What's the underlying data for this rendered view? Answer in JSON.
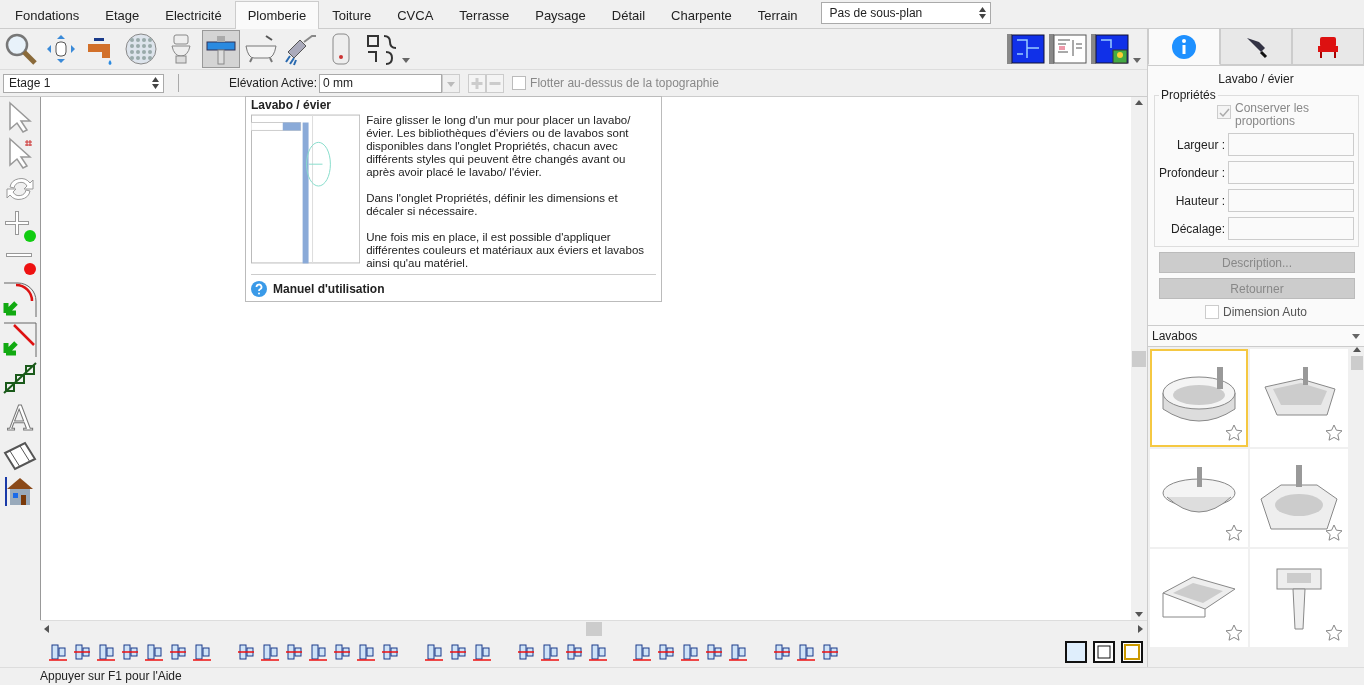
{
  "tabs": [
    {
      "label": "Fondations",
      "selected": false
    },
    {
      "label": "Etage",
      "selected": false
    },
    {
      "label": "Electricité",
      "selected": false
    },
    {
      "label": "Plomberie",
      "selected": true
    },
    {
      "label": "Toiture",
      "selected": false
    },
    {
      "label": "CVCA",
      "selected": false
    },
    {
      "label": "Terrasse",
      "selected": false
    },
    {
      "label": "Paysage",
      "selected": false
    },
    {
      "label": "Détail",
      "selected": false
    },
    {
      "label": "Charpente",
      "selected": false
    },
    {
      "label": "Terrain",
      "selected": false
    }
  ],
  "plan_select": {
    "value": "Pas de sous-plan"
  },
  "toolbar": [
    {
      "kind": "zoom",
      "selected": false
    },
    {
      "kind": "pan",
      "selected": false
    },
    {
      "kind": "faucet",
      "selected": false
    },
    {
      "kind": "drain",
      "selected": false
    },
    {
      "kind": "toilet",
      "selected": false
    },
    {
      "kind": "sink",
      "selected": true
    },
    {
      "kind": "bathtub",
      "selected": false
    },
    {
      "kind": "shower",
      "selected": false
    },
    {
      "kind": "heater",
      "selected": false
    },
    {
      "kind": "pipes",
      "selected": false
    }
  ],
  "floor_select": {
    "value": "Etage 1"
  },
  "elevation": {
    "label": "Elévation Active:",
    "value": "0 mm"
  },
  "float_option": {
    "label": "Flotter au-dessus de la topographie",
    "checked": false
  },
  "text_tool": {
    "glyph": "A"
  },
  "tooltip": {
    "title": "Lavabo / évier",
    "paragraphs": [
      "Faire glisser le long d'un mur pour placer un lavabo/évier. Les bibliothèques d'éviers ou de lavabos sont disponibles dans l'onglet Propriétés, chacun avec différents styles qui peuvent être changés avant ou après avoir placé le lavabo/ l'évier.",
      "Dans l'onglet Propriétés, définir les dimensions et décaler si nécessaire.",
      "Une fois mis en place, il est possible d'appliquer différentes couleurs et matériaux aux éviers et lavabos ainsi qu'au matériel."
    ],
    "help_link": "Manuel d'utilisation"
  },
  "panel_tabs": [
    {
      "kind": "info",
      "selected": true
    },
    {
      "kind": "pen",
      "selected": false
    },
    {
      "kind": "chair",
      "selected": false
    }
  ],
  "panel": {
    "title": "Lavabo / évier",
    "group": "Propriétés",
    "keep_proportions": {
      "label": "Conserver les proportions",
      "checked": true,
      "disabled": true
    },
    "fields": [
      {
        "label": "Largeur :"
      },
      {
        "label": "Profondeur :"
      },
      {
        "label": "Hauteur :"
      },
      {
        "label": "Décalage:"
      }
    ],
    "buttons": [
      {
        "label": "Description...",
        "disabled": true
      },
      {
        "label": "Retourner",
        "disabled": true
      }
    ],
    "auto_dimension": {
      "label": "Dimension Auto",
      "checked": false
    }
  },
  "library": {
    "title": "Lavabos",
    "items": [
      {
        "kind": "round",
        "selected": true
      },
      {
        "kind": "square",
        "selected": false
      },
      {
        "kind": "bowl",
        "selected": false
      },
      {
        "kind": "oval",
        "selected": false
      },
      {
        "kind": "rect",
        "selected": false
      },
      {
        "kind": "pedestal",
        "selected": false
      }
    ]
  },
  "status_bar": "Appuyer sur F1 pour l'Aide"
}
